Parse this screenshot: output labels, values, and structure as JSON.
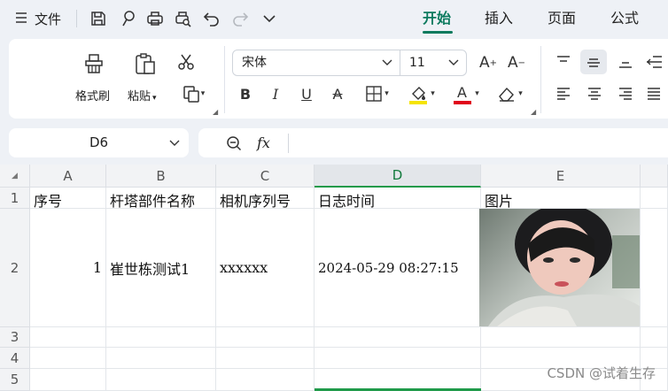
{
  "menubar": {
    "file_label": "文件",
    "tabs": [
      {
        "label": "开始",
        "active": true
      },
      {
        "label": "插入",
        "active": false
      },
      {
        "label": "页面",
        "active": false
      },
      {
        "label": "公式",
        "active": false
      }
    ],
    "quick_icons": [
      "save-icon",
      "format-painter-icon",
      "print-icon",
      "print-preview-icon",
      "undo-icon",
      "redo-icon",
      "more-chevron-icon"
    ]
  },
  "ribbon": {
    "format_painter_label": "格式刷",
    "paste_label": "粘贴",
    "font_name": "宋体",
    "font_size": "11",
    "accent_color": "#0b7a5e",
    "highlight_color": "#f5e400",
    "font_color": "#e0001b"
  },
  "formula_bar": {
    "name_box": "D6",
    "fx_label": "fx",
    "formula_value": ""
  },
  "sheet": {
    "corner": "◢",
    "columns": [
      "A",
      "B",
      "C",
      "D",
      "E"
    ],
    "rows": [
      "1",
      "2",
      "3",
      "4",
      "5"
    ],
    "header_row": {
      "a": "序号",
      "b": "杆塔部件名称",
      "c": "相机序列号",
      "d": "日志时间",
      "e": "图片"
    },
    "data_row": {
      "a": "1",
      "b": "崔世栋测试1",
      "c": "xxxxxx",
      "d": "2024-05-29 08:27:15"
    },
    "selected_column": "D"
  },
  "watermark": "CSDN @试着生存"
}
